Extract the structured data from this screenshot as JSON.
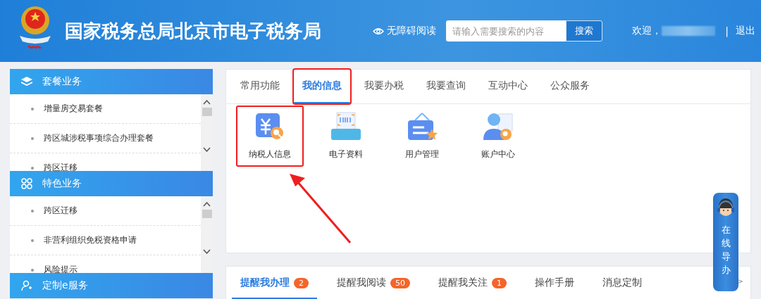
{
  "header": {
    "title": "国家税务总局北京市电子税务局",
    "accessibility_link": "无障碍阅读",
    "search": {
      "placeholder": "请输入需要搜索的内容",
      "button": "搜索"
    },
    "welcome": "欢迎，",
    "separator": "|",
    "logout": "退出"
  },
  "sidebar": {
    "sections": [
      {
        "title": "套餐业务",
        "kind": "layers",
        "items": [
          "增量房交易套餐",
          "跨区城涉税事项综合办理套餐",
          "跨区迁移"
        ]
      },
      {
        "title": "特色业务",
        "kind": "grid",
        "items": [
          "跨区迁移",
          "非营利组织免税资格申请",
          "风险提示"
        ]
      },
      {
        "title": "定制e服务",
        "kind": "user"
      }
    ]
  },
  "main_tabs": [
    {
      "label": "常用功能",
      "selected": false,
      "highlighted": false
    },
    {
      "label": "我的信息",
      "selected": true,
      "highlighted": true
    },
    {
      "label": "我要办税",
      "selected": false,
      "highlighted": false
    },
    {
      "label": "我要查询",
      "selected": false,
      "highlighted": false
    },
    {
      "label": "互动中心",
      "selected": false,
      "highlighted": false
    },
    {
      "label": "公众服务",
      "selected": false,
      "highlighted": false
    }
  ],
  "functions": [
    {
      "label": "纳税人信息",
      "kind": "receipt",
      "highlighted": true
    },
    {
      "label": "电子资料",
      "kind": "printer",
      "highlighted": false
    },
    {
      "label": "用户管理",
      "kind": "board",
      "highlighted": false
    },
    {
      "label": "账户中心",
      "kind": "person",
      "highlighted": false
    }
  ],
  "notice_tabs": [
    {
      "label": "提醒我办理",
      "badge": "2",
      "selected": true
    },
    {
      "label": "提醒我阅读",
      "badge": "50",
      "selected": false
    },
    {
      "label": "提醒我关注",
      "badge": "1",
      "selected": false
    },
    {
      "label": "操作手册",
      "selected": false
    },
    {
      "label": "消息定制",
      "selected": false
    }
  ],
  "more_link": ">",
  "online_guide": {
    "label": "在线导办"
  }
}
